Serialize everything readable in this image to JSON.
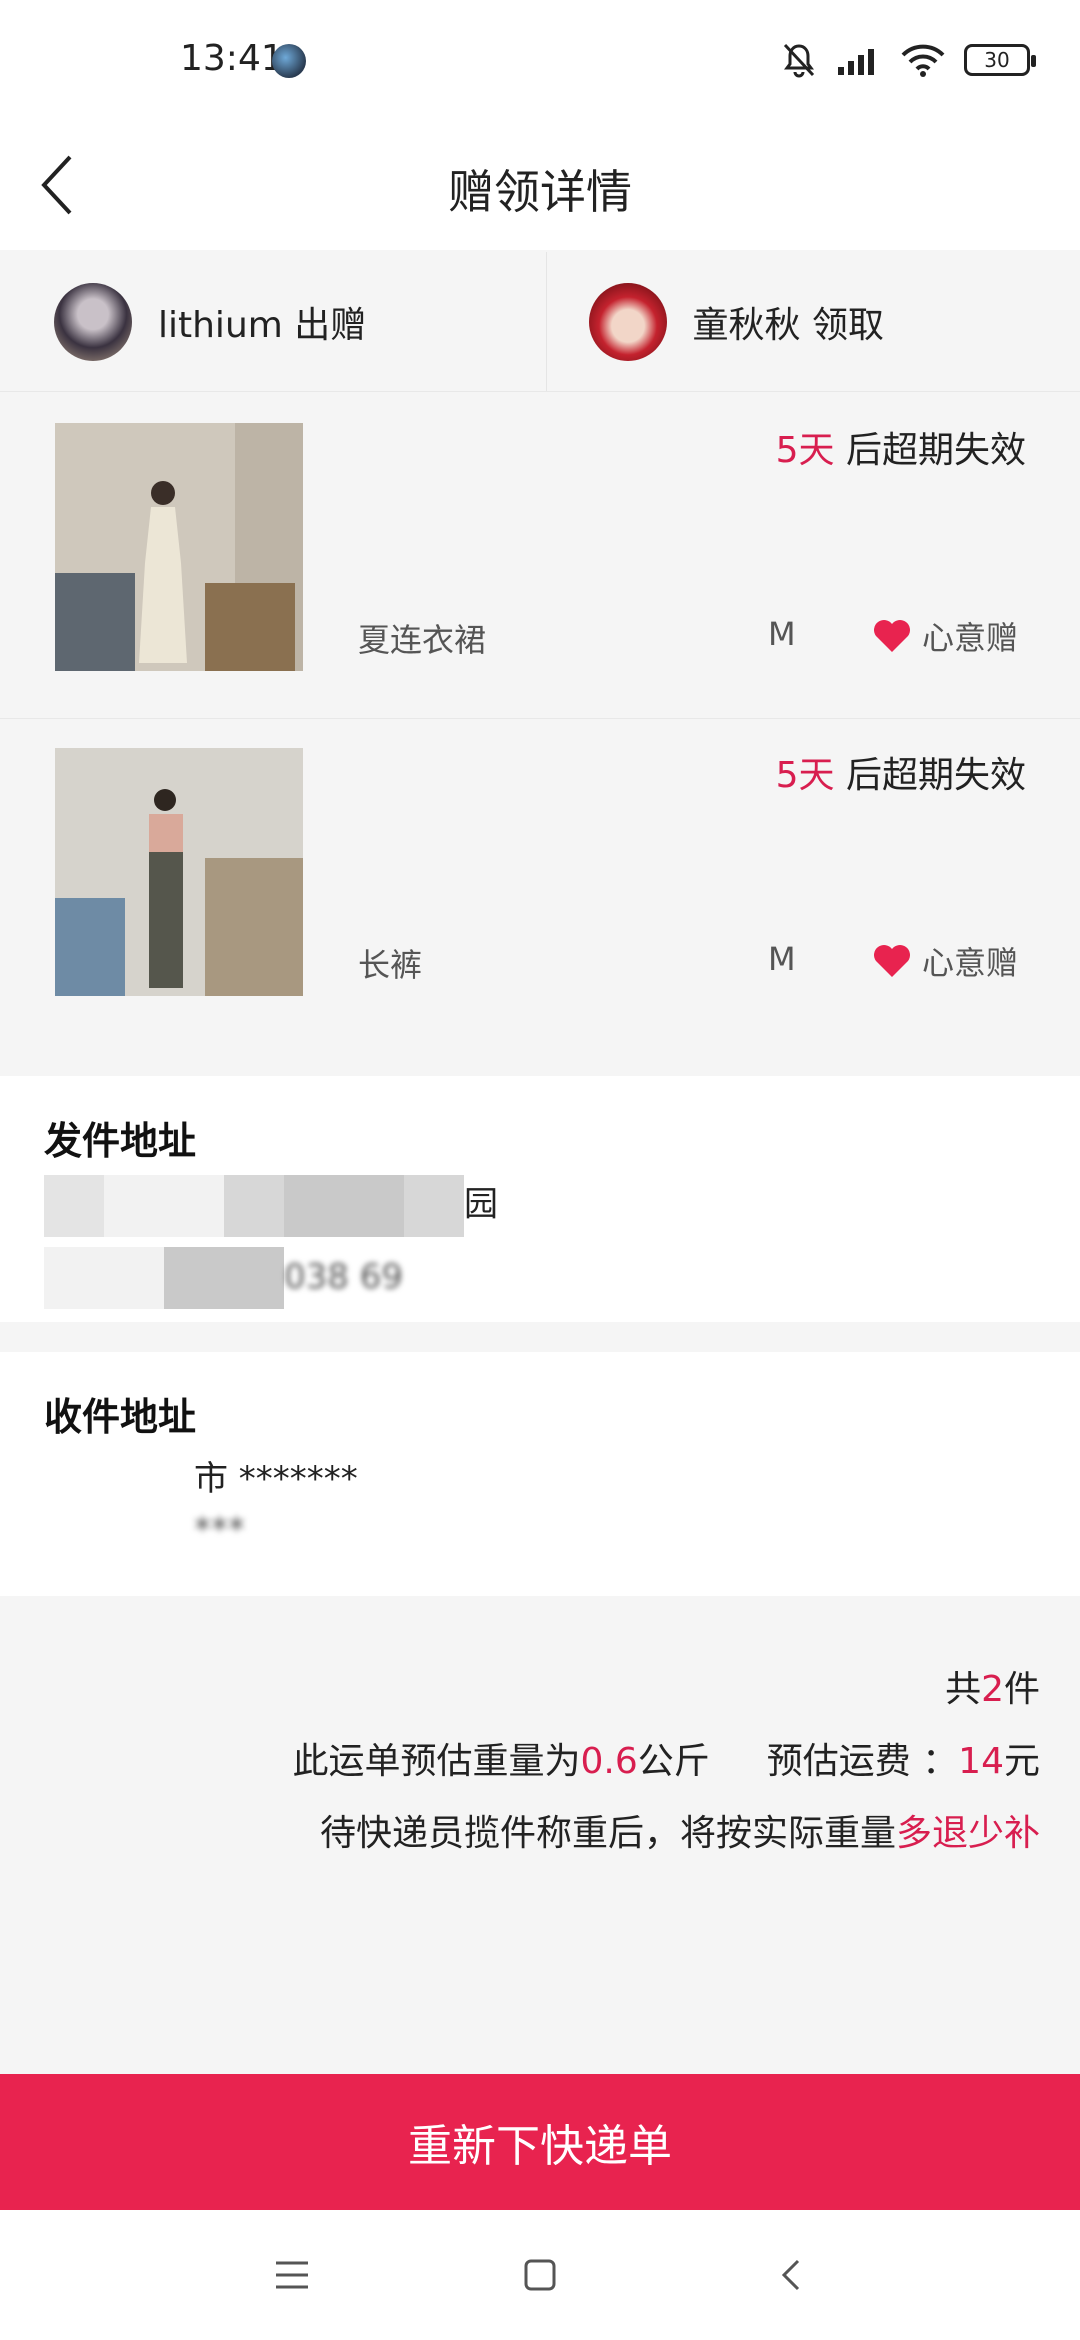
{
  "status": {
    "time": "13:41",
    "battery": "30"
  },
  "header": {
    "title": "赠领详情"
  },
  "parties": {
    "giver": {
      "text": "lithium 出赠"
    },
    "receiver": {
      "text": "童秋秋 领取"
    }
  },
  "items": [
    {
      "expiry_days": "5天",
      "expiry_suffix": " 后超期失效",
      "name": "夏连衣裙",
      "size": "M",
      "type": "心意赠"
    },
    {
      "expiry_days": "5天",
      "expiry_suffix": " 后超期失效",
      "name": "长裤",
      "size": "M",
      "type": "心意赠"
    }
  ],
  "send_address": {
    "title": "发件地址",
    "line1": "园",
    "line2": "038 69"
  },
  "recv_address": {
    "title": "收件地址",
    "line1": "市 *******",
    "line2": "***"
  },
  "summary": {
    "count_prefix": "共",
    "count": "2",
    "count_suffix": "件",
    "weight_prefix": "此运单预估重量为",
    "weight": "0.6",
    "weight_unit": "公斤",
    "fee_prefix": "预估运费 ：",
    "fee": "14",
    "fee_unit": "元",
    "note_prefix": "待快递员揽件称重后，将按实际重量",
    "note_highlight": "多退少补"
  },
  "actions": {
    "reorder": "重新下快递单"
  },
  "colors": {
    "accent": "#e8234f",
    "highlight": "#d81e4f"
  }
}
